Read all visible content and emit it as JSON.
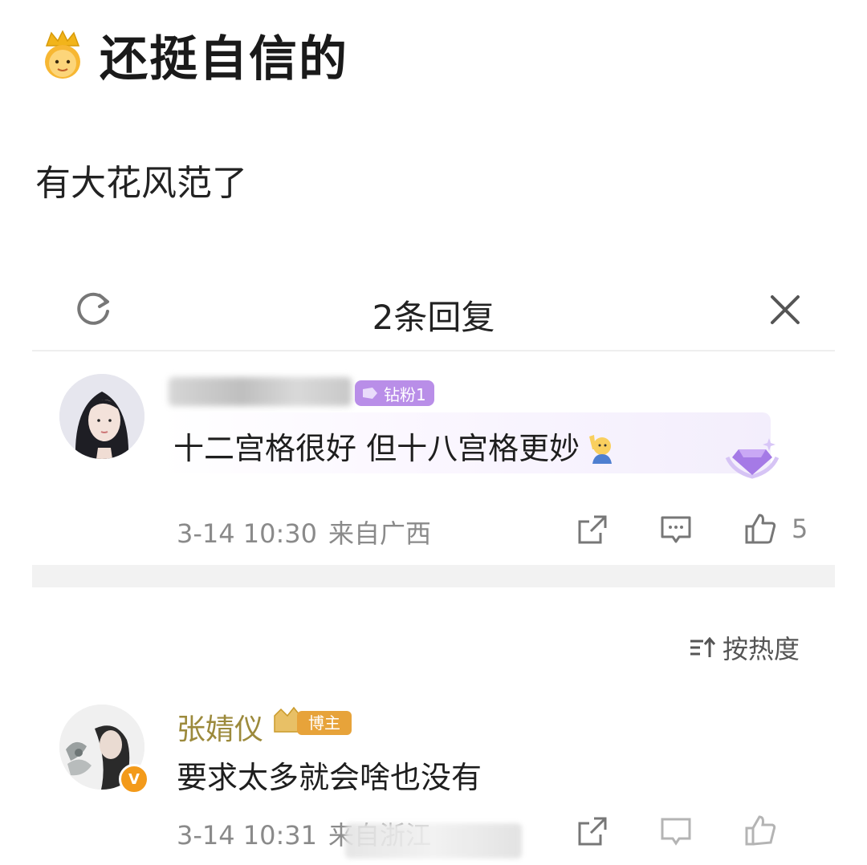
{
  "post": {
    "title": "还挺自信的",
    "body": "有大花风范了"
  },
  "reply_panel": {
    "title": "2条回复"
  },
  "reply": {
    "fan_badge": "钻粉1",
    "text": "十二宫格很好 但十八宫格更妙",
    "time": "3-14 10:30",
    "location": "来自广西",
    "likes": "5"
  },
  "sort": {
    "label": "按热度"
  },
  "blogger_comment": {
    "name": "张婧仪",
    "badge": "博主",
    "text": "要求太多就会啥也没有",
    "time": "3-14 10:31",
    "location": "来自浙江"
  },
  "colors": {
    "accent_purple": "#b98ee8",
    "blogger_gold": "#9c8a3c",
    "verified_orange": "#f39a1a",
    "meta_gray": "#8a8a8a"
  }
}
